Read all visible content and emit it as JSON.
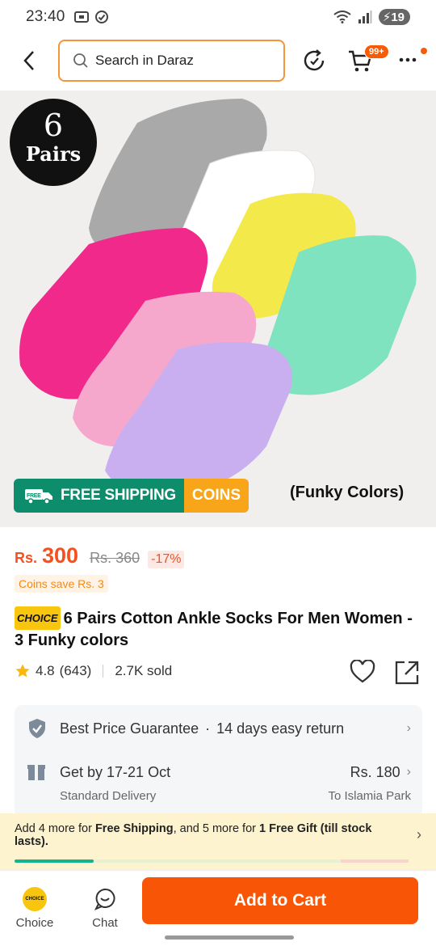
{
  "status_bar": {
    "time": "23:40",
    "battery": "19"
  },
  "search": {
    "placeholder": "Search in Daraz"
  },
  "cart": {
    "badge": "99+"
  },
  "product_image": {
    "badge_number": "6",
    "badge_word": "Pairs",
    "free_label": "FREE",
    "free_shipping": "FREE SHIPPING",
    "coins": "COINS",
    "caption": "(Funky Colors)",
    "sock_colors": [
      "#a9a9a9",
      "#ffffff",
      "#f4e94a",
      "#7fe3c0",
      "#f0298a",
      "#f6a8cc",
      "#c9aef0"
    ]
  },
  "price": {
    "currency": "Rs.",
    "current": "300",
    "original": "Rs. 360",
    "discount": "-17%",
    "coins_save": "Coins save Rs. 3"
  },
  "title": {
    "choice_tag": "CHOICE",
    "text": "6 Pairs Cotton Ankle Socks For Men Women - 3 Funky colors"
  },
  "rating": {
    "score": "4.8",
    "count": "(643)",
    "sold": "2.7K sold"
  },
  "info_card": {
    "guarantee": "Best Price Guarantee",
    "separator": "·",
    "return": "14 days easy return",
    "delivery_date": "Get by 17-21 Oct",
    "delivery_fee": "Rs. 180",
    "delivery_type": "Standard Delivery",
    "destination": "To Islamia Park"
  },
  "promo": {
    "text_1": "Add 4 more for ",
    "bold_1": "Free Shipping",
    "text_2": ", and 5 more for ",
    "bold_2": "1 Free Gift (till stock lasts).",
    "progress": 0.2
  },
  "bottom_bar": {
    "choice_icon_text": "CHOICE",
    "choice_label": "Choice",
    "chat_label": "Chat",
    "add_to_cart": "Add to Cart"
  },
  "colors": {
    "accent": "#f85606",
    "price": "#f5501e",
    "shipping_green": "#0e8d6d",
    "coins_orange": "#f9a51a"
  }
}
